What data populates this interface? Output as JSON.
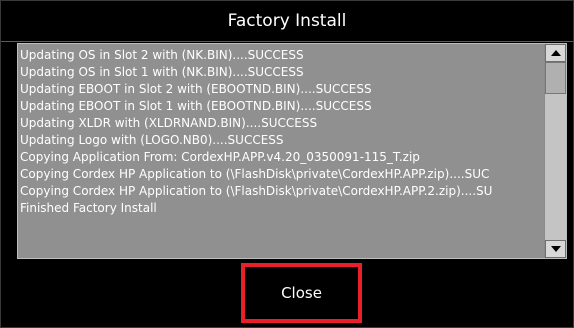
{
  "dialog": {
    "title": "Factory Install",
    "close_label": "Close",
    "highlight_color": "#e8202a",
    "log_background": "#909090"
  },
  "log": {
    "lines": [
      "Updating OS in Slot 2 with (NK.BIN)....SUCCESS",
      "Updating OS in Slot 1 with (NK.BIN)....SUCCESS",
      "Updating EBOOT in Slot 2 with (EBOOTND.BIN)....SUCCESS",
      "Updating EBOOT in Slot 1 with (EBOOTND.BIN)....SUCCESS",
      "Updating XLDR with (XLDRNAND.BIN)....SUCCESS",
      "Updating Logo with (LOGO.NB0)....SUCCESS",
      "Copying Application From: CordexHP.APP.v4.20_0350091-115_T.zip",
      "Copying Cordex HP Application to (\\FlashDisk\\private\\CordexHP.APP.zip)....SUC",
      "Copying Cordex HP Application to (\\FlashDisk\\private\\CordexHP.APP.2.zip)....SU",
      "Finished Factory Install"
    ]
  },
  "scrollbar": {
    "up_icon": "arrow-up",
    "down_icon": "arrow-down"
  }
}
